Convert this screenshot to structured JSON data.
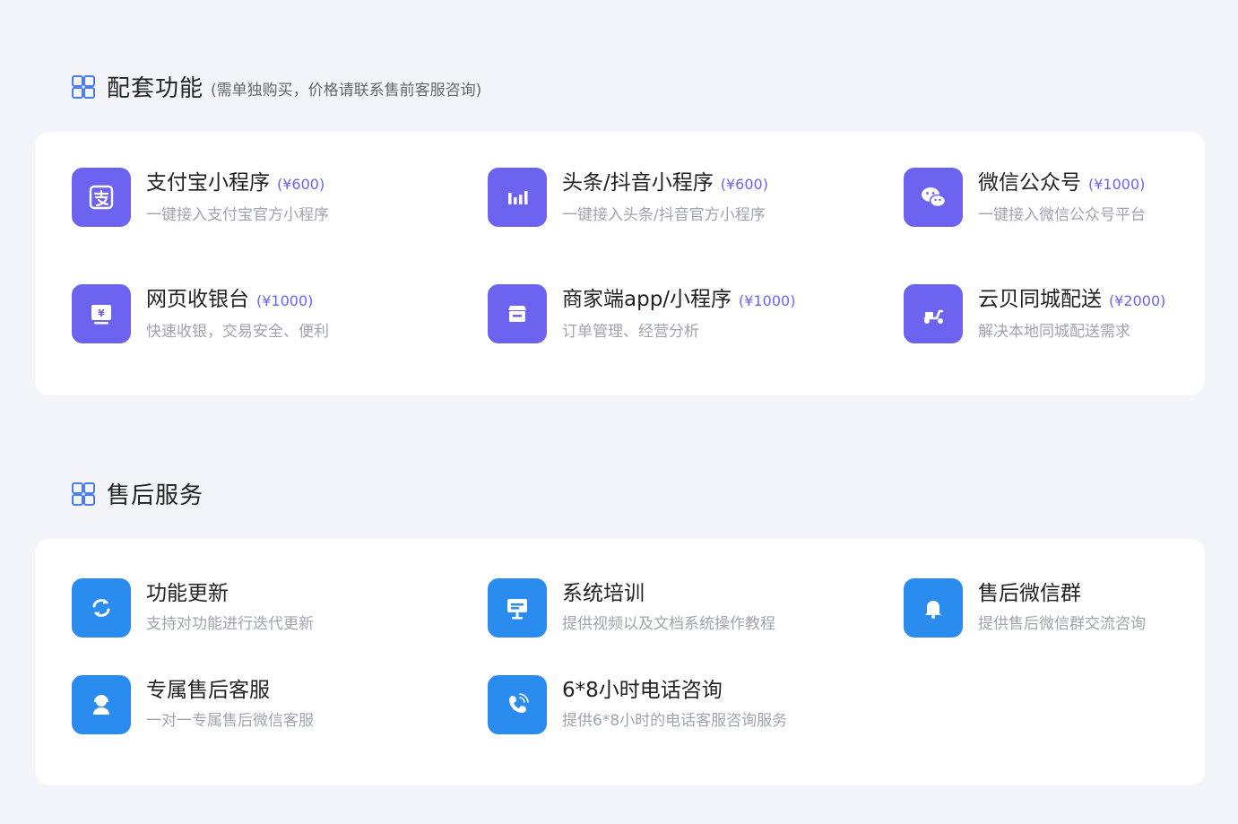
{
  "sections": {
    "addons": {
      "title": "配套功能",
      "note": "(需单独购买，价格请联系售前客服咨询)",
      "items": [
        {
          "name": "支付宝小程序",
          "price": "(¥600)",
          "desc": "一键接入支付宝官方小程序",
          "icon": "alipay-icon"
        },
        {
          "name": "头条/抖音小程序",
          "price": "(¥600)",
          "desc": "一键接入头条/抖音官方小程序",
          "icon": "bar-chart-icon"
        },
        {
          "name": "微信公众号",
          "price": "(¥1000)",
          "desc": "一键接入微信公众号平台",
          "icon": "wechat-icon"
        },
        {
          "name": "网页收银台",
          "price": "(¥1000)",
          "desc": "快速收银，交易安全、便利",
          "icon": "cashier-icon"
        },
        {
          "name": "商家端app/小程序",
          "price": "(¥1000)",
          "desc": "订单管理、经营分析",
          "icon": "store-icon"
        },
        {
          "name": "云贝同城配送",
          "price": "(¥2000)",
          "desc": "解决本地同城配送需求",
          "icon": "scooter-icon"
        }
      ]
    },
    "aftersales": {
      "title": "售后服务",
      "items": [
        {
          "name": "功能更新",
          "desc": "支持对功能进行迭代更新",
          "icon": "refresh-icon"
        },
        {
          "name": "系统培训",
          "desc": "提供视频以及文档系统操作教程",
          "icon": "presentation-icon"
        },
        {
          "name": "售后微信群",
          "desc": "提供售后微信群交流咨询",
          "icon": "bell-icon"
        },
        {
          "name": "专属售后客服",
          "desc": "一对一专属售后微信客服",
          "icon": "headset-icon"
        },
        {
          "name": "6*8小时电话咨询",
          "desc": "提供6*8小时的电话客服咨询服务",
          "icon": "phone-icon"
        }
      ]
    }
  },
  "colors": {
    "purple": "#6c63f0",
    "blue": "#2b8cf0",
    "accent": "#4a7cf3"
  }
}
